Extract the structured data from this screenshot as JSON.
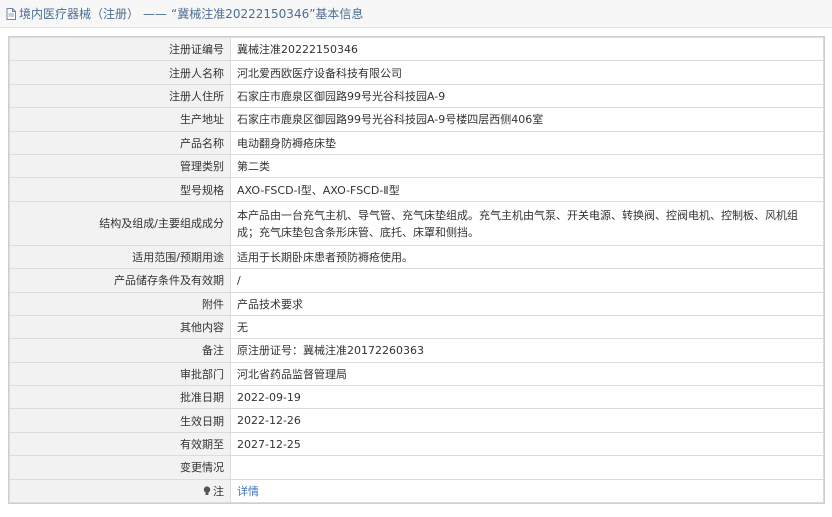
{
  "header": {
    "category": "境内医疗器械（注册）",
    "separator": "——",
    "title": "“冀械注准20222150346”基本信息"
  },
  "rows": [
    {
      "label": "注册证编号",
      "value": "冀械注准20222150346"
    },
    {
      "label": "注册人名称",
      "value": "河北爱西欧医疗设备科技有限公司"
    },
    {
      "label": "注册人住所",
      "value": "石家庄市鹿泉区御园路99号光谷科技园A-9"
    },
    {
      "label": "生产地址",
      "value": "石家庄市鹿泉区御园路99号光谷科技园A-9号楼四层西侧406室"
    },
    {
      "label": "产品名称",
      "value": "电动翻身防褥疮床垫"
    },
    {
      "label": "管理类别",
      "value": "第二类"
    },
    {
      "label": "型号规格",
      "value": "AXO-FSCD-Ⅰ型、AXO-FSCD-Ⅱ型"
    },
    {
      "label": "结构及组成/主要组成成分",
      "value": "本产品由一台充气主机、导气管、充气床垫组成。充气主机由气泵、开关电源、转换阀、控阀电机、控制板、风机组成；充气床垫包含条形床管、底托、床罩和侧挡。"
    },
    {
      "label": "适用范围/预期用途",
      "value": "适用于长期卧床患者预防褥疮使用。"
    },
    {
      "label": "产品储存条件及有效期",
      "value": "/"
    },
    {
      "label": "附件",
      "value": "产品技术要求"
    },
    {
      "label": "其他内容",
      "value": "无"
    },
    {
      "label": "备注",
      "value": "原注册证号：冀械注准20172260363"
    },
    {
      "label": "审批部门",
      "value": "河北省药品监督管理局"
    },
    {
      "label": "批准日期",
      "value": "2022-09-19"
    },
    {
      "label": "生效日期",
      "value": "2022-12-26"
    },
    {
      "label": "有效期至",
      "value": "2027-12-25"
    },
    {
      "label": "变更情况",
      "value": ""
    },
    {
      "label": "注",
      "value": "详情"
    }
  ],
  "icons": {
    "header": "document-icon",
    "note": "lightbulb-icon"
  },
  "colors": {
    "header_text": "#4d6d93",
    "link": "#3d74b6",
    "label_bg": "#f2f2f2"
  }
}
